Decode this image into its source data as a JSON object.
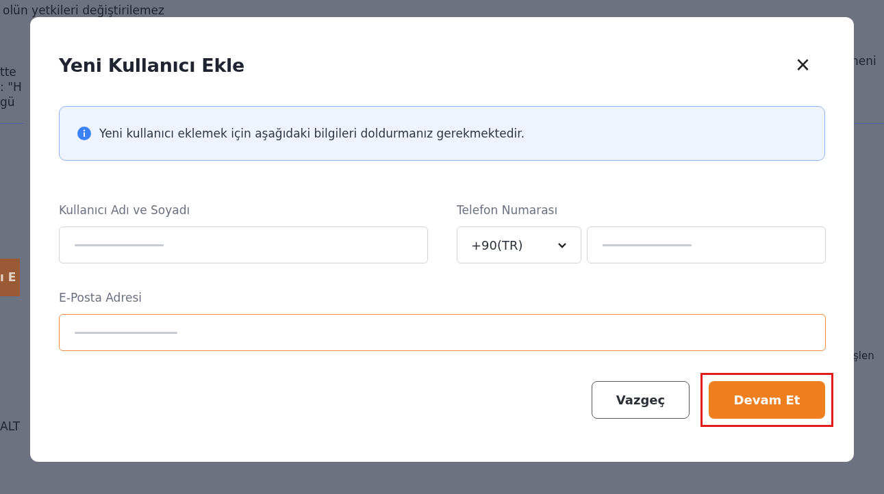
{
  "background": {
    "fragments": [
      {
        "kind": "text",
        "text": "olün yetkileri değiştirilemez"
      },
      {
        "kind": "text",
        "text": "tte"
      },
      {
        "kind": "text",
        "text": ": \"H"
      },
      {
        "kind": "text",
        "text": "gü"
      },
      {
        "kind": "button",
        "text": "ı E"
      },
      {
        "kind": "text",
        "text": "ALT"
      },
      {
        "kind": "text",
        "text": "neni"
      },
      {
        "kind": "text",
        "text": "şlen"
      }
    ]
  },
  "dialog": {
    "title": "Yeni Kullanıcı Ekle",
    "close": "×",
    "info": "Yeni kullanıcı eklemek için aşağıdaki bilgileri doldurmanız gerekmektedir.",
    "fields": [
      {
        "kind": "text",
        "label": "Kullanıcı Adı ve Soyadı",
        "focused": false
      },
      {
        "kind": "phone",
        "label": "Telefon Numarası",
        "country": "+90(TR)",
        "focused": false
      },
      {
        "kind": "text",
        "label": "E-Posta Adresi",
        "focused": true
      }
    ],
    "buttons": [
      {
        "kind": "secondary",
        "label": "Vazgeç",
        "highlighted": false
      },
      {
        "kind": "primary",
        "label": "Devam Et",
        "highlighted": true
      }
    ]
  }
}
